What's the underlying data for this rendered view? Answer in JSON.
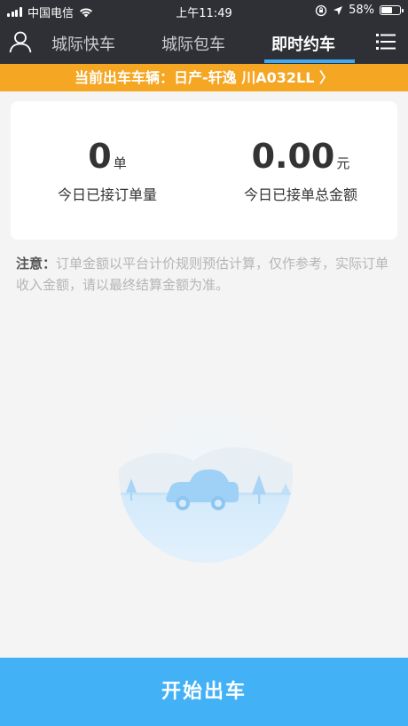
{
  "status_bar": {
    "carrier": "中国电信",
    "time": "上午11:49",
    "battery": "58%",
    "battery_level": 0.58
  },
  "nav": {
    "tabs": [
      {
        "label": "城际快车",
        "active": false
      },
      {
        "label": "城际包车",
        "active": false
      },
      {
        "label": "即时约车",
        "active": true
      }
    ],
    "user_icon": "user-icon",
    "menu_icon": "menu-icon",
    "active_color": "#3fa9f5"
  },
  "vehicle": {
    "text": "当前出车车辆：日产-轩逸 川A032LL 〉",
    "color": "#f5a623"
  },
  "stats": {
    "orders": {
      "value": "0",
      "unit": "单",
      "label": "今日已接订单量"
    },
    "amount": {
      "value": "0.00",
      "unit": "元",
      "label": "今日已接单总金额"
    }
  },
  "notice": {
    "title": "注意：",
    "text": "订单金额以平台计价规则预估计算，仅作参考，实际订单收入金额，请以最终结算金额为准。"
  },
  "action": {
    "label": "开始出车",
    "color": "#43b1f5"
  }
}
